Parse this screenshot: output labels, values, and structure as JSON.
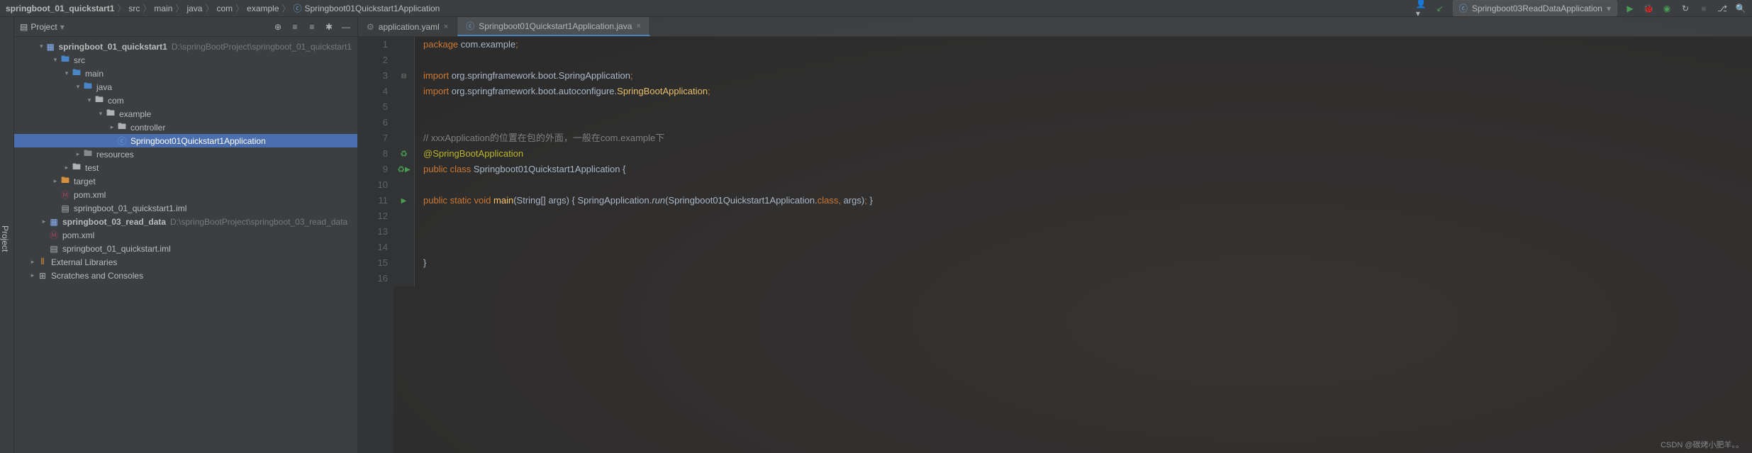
{
  "breadcrumb": [
    "springboot_01_quickstart1",
    "src",
    "main",
    "java",
    "com",
    "example",
    "Springboot01Quickstart1Application"
  ],
  "runConfig": "Springboot03ReadDataApplication",
  "panel": {
    "title": "Project"
  },
  "tree": [
    {
      "indent": 0,
      "arrow": "down",
      "icon": "module",
      "label": "springboot_01_quickstart1",
      "path": "D:\\springBootProject\\springboot_01_quickstart1",
      "bold": true
    },
    {
      "indent": 1,
      "arrow": "down",
      "icon": "folder-blue",
      "label": "src"
    },
    {
      "indent": 2,
      "arrow": "down",
      "icon": "folder-blue",
      "label": "main"
    },
    {
      "indent": 3,
      "arrow": "down",
      "icon": "folder-blue",
      "label": "java"
    },
    {
      "indent": 4,
      "arrow": "down",
      "icon": "folder",
      "label": "com"
    },
    {
      "indent": 5,
      "arrow": "down",
      "icon": "folder",
      "label": "example"
    },
    {
      "indent": 6,
      "arrow": "right",
      "icon": "folder",
      "label": "controller"
    },
    {
      "indent": 6,
      "arrow": "",
      "icon": "class",
      "label": "Springboot01Quickstart1Application",
      "selected": true
    },
    {
      "indent": 3,
      "arrow": "right",
      "icon": "folder-gray",
      "label": "resources"
    },
    {
      "indent": 2,
      "arrow": "right",
      "icon": "folder",
      "label": "test"
    },
    {
      "indent": 1,
      "arrow": "right",
      "icon": "folder-orange",
      "label": "target"
    },
    {
      "indent": 1,
      "arrow": "",
      "icon": "maven",
      "label": "pom.xml"
    },
    {
      "indent": 1,
      "arrow": "",
      "icon": "file",
      "label": "springboot_01_quickstart1.iml"
    },
    {
      "indent": 0,
      "arrow": "right",
      "icon": "module",
      "label": "springboot_03_read_data",
      "path": "D:\\springBootProject\\springboot_03_read_data",
      "bold": true
    },
    {
      "indent": 0,
      "arrow": "",
      "icon": "maven",
      "label": "pom.xml"
    },
    {
      "indent": 0,
      "arrow": "",
      "icon": "file",
      "label": "springboot_01_quickstart.iml"
    },
    {
      "indent": -1,
      "arrow": "right",
      "icon": "lib",
      "label": "External Libraries"
    },
    {
      "indent": -1,
      "arrow": "right",
      "icon": "scratch",
      "label": "Scratches and Consoles"
    }
  ],
  "tabs": [
    {
      "icon": "yaml",
      "label": "application.yaml",
      "active": false
    },
    {
      "icon": "class",
      "label": "Springboot01Quickstart1Application.java",
      "active": true
    }
  ],
  "code": {
    "lines": [
      {
        "n": 1,
        "html": "<span class='kw'>package</span> <span class='plain'>com.example</span><span class='punct'>;</span>"
      },
      {
        "n": 2,
        "html": ""
      },
      {
        "n": 3,
        "html": "<span class='kw'>import</span> <span class='plain'>org.springframework.boot.SpringApplication</span><span class='punct'>;</span>",
        "gutter": "fold"
      },
      {
        "n": 4,
        "html": "<span class='kw'>import</span> <span class='plain'>org.springframework.boot.autoconfigure.</span><span class='cls'>SpringBootApplication</span><span class='punct'>;</span>"
      },
      {
        "n": 5,
        "html": ""
      },
      {
        "n": 6,
        "html": ""
      },
      {
        "n": 7,
        "html": "<span class='comment'>// xxxApplication的位置在包的外面，一般在com.example下</span>"
      },
      {
        "n": 8,
        "html": "<span class='ann'>@SpringBootApplication</span>",
        "gutter": "recycle"
      },
      {
        "n": 9,
        "html": "<span class='kw'>public class</span> <span class='plain'>Springboot01Quickstart1Application </span><span class='plain'>{</span>",
        "gutter": "recycle-play"
      },
      {
        "n": 10,
        "html": ""
      },
      {
        "n": 11,
        "html": "    <span class='kw'>public static void</span> <span class='fn'>main</span><span class='plain'>(String[] args) {  SpringApplication.</span><span class='italic plain'>run</span><span class='plain'>(Springboot01Quickstart1Application.</span><span class='kw'>class</span><span class='punct'>,</span> <span class='plain'>args)</span><span class='punct'>;</span>  <span class='plain'>}</span>",
        "gutter": "play"
      },
      {
        "n": 12,
        "html": ""
      },
      {
        "n": 13,
        "html": ""
      },
      {
        "n": 14,
        "html": ""
      },
      {
        "n": 15,
        "html": "<span class='plain'>}</span>"
      },
      {
        "n": 16,
        "html": ""
      }
    ]
  },
  "watermark": "CSDN @碳烤小肥羊。。"
}
